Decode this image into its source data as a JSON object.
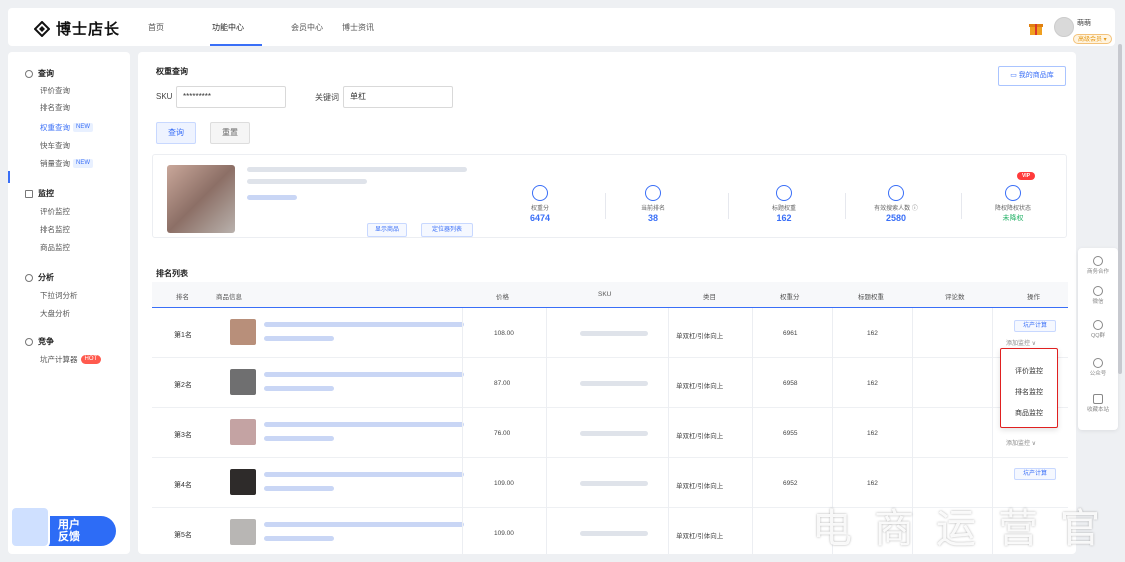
{
  "brand": {
    "logo_text": "博士店长"
  },
  "nav": {
    "tabs": [
      "首页",
      "功能中心",
      "会员中心",
      "博士资讯"
    ],
    "active_index": 1
  },
  "user": {
    "name": "萌萌",
    "badge": "高级会员 ▾"
  },
  "sidebar": {
    "groups": [
      {
        "label": "查询",
        "items": [
          {
            "label": "评价查询"
          },
          {
            "label": "排名查询"
          },
          {
            "label": "权重查询",
            "tag": "NEW",
            "active": true
          },
          {
            "label": "快车查询"
          },
          {
            "label": "销量查询",
            "tag": "NEW"
          }
        ]
      },
      {
        "label": "监控",
        "items": [
          {
            "label": "评价监控"
          },
          {
            "label": "排名监控"
          },
          {
            "label": "商品监控"
          }
        ]
      },
      {
        "label": "分析",
        "items": [
          {
            "label": "下拉词分析"
          },
          {
            "label": "大盘分析"
          }
        ]
      },
      {
        "label": "竞争",
        "items": [
          {
            "label": "坑产计算器",
            "tag": "HOT"
          }
        ]
      }
    ],
    "feedback": {
      "line1": "用户",
      "line2": "反馈"
    }
  },
  "search": {
    "title": "权重查询",
    "sku_label": "SKU",
    "sku_value": "*********",
    "keyword_label": "关键词",
    "keyword_value": "单杠",
    "query_btn": "查询",
    "reset_btn": "重置",
    "library_btn": "我的商品库"
  },
  "product": {
    "btn_show": "显示商品",
    "btn_locate": "定位器列表",
    "vip_tag": "VIP",
    "stats": [
      {
        "label": "权重分",
        "value": "6474",
        "icon": "clock-icon"
      },
      {
        "label": "当前排名",
        "value": "38",
        "icon": "chart-icon"
      },
      {
        "label": "标题权重",
        "value": "162",
        "icon": "list-icon"
      },
      {
        "label": "有效搜索人数 ⓘ",
        "value": "2580",
        "icon": "users-icon"
      },
      {
        "label": "降权降权状态",
        "value": "未降权",
        "icon": "arrow-icon"
      }
    ]
  },
  "ranking": {
    "title": "排名列表",
    "headers": [
      "排名",
      "商品信息",
      "价格",
      "SKU",
      "类目",
      "权重分",
      "标题权重",
      "评论数",
      "操作"
    ],
    "rows": [
      {
        "rank": "第1名",
        "price": "108.00",
        "category": "单双杠/引体向上",
        "weight": "6961",
        "title_weight": "162",
        "img": "#b88f7a"
      },
      {
        "rank": "第2名",
        "price": "87.00",
        "category": "单双杠/引体向上",
        "weight": "6958",
        "title_weight": "162",
        "img": "#6f6f70"
      },
      {
        "rank": "第3名",
        "price": "76.00",
        "category": "单双杠/引体向上",
        "weight": "6955",
        "title_weight": "162",
        "img": "#c4a3a3"
      },
      {
        "rank": "第4名",
        "price": "109.00",
        "category": "单双杠/引体向上",
        "weight": "6952",
        "title_weight": "162",
        "img": "#2e2b2a"
      },
      {
        "rank": "第5名",
        "price": "109.00",
        "category": "单双杠/引体向上",
        "weight": "",
        "title_weight": "",
        "img": "#b8b6b4"
      }
    ],
    "op_calc": "坑产计算",
    "op_add": "添加监控 ∨"
  },
  "dropdown": {
    "items": [
      "评价监控",
      "排名监控",
      "商品监控"
    ]
  },
  "floatbar": {
    "items": [
      "商务合作",
      "微信",
      "QQ群",
      "公众号",
      "收藏本站"
    ]
  },
  "watermark": "电商运营官"
}
